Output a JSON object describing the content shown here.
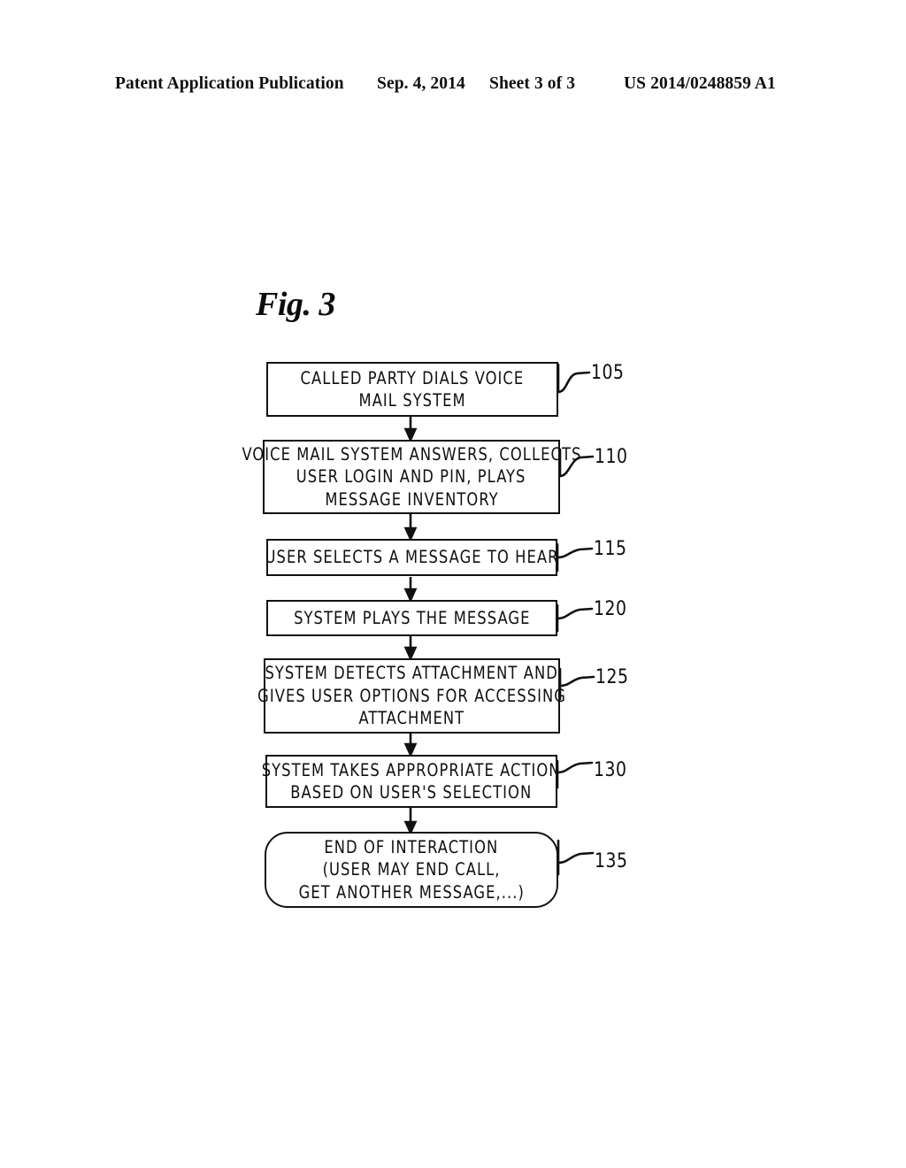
{
  "header": {
    "publication": "Patent Application Publication",
    "date": "Sep. 4, 2014",
    "sheet": "Sheet 3 of 3",
    "patent_number": "US 2014/0248859 A1"
  },
  "figure": {
    "label": "Fig. 3",
    "type": "flowchart",
    "ink_color": "#121010",
    "background_color": "#ffffff"
  },
  "chart_data": {
    "type": "diagram",
    "title": "Fig. 3",
    "nodes": [
      {
        "ref": "105",
        "shape": "rectangle",
        "lines": [
          "CALLED PARTY DIALS VOICE",
          "MAIL SYSTEM"
        ]
      },
      {
        "ref": "110",
        "shape": "rectangle",
        "lines": [
          "VOICE MAIL SYSTEM ANSWERS, COLLECTS",
          "USER LOGIN AND PIN, PLAYS",
          "MESSAGE INVENTORY"
        ]
      },
      {
        "ref": "115",
        "shape": "rectangle",
        "lines": [
          "USER SELECTS A MESSAGE TO HEAR"
        ]
      },
      {
        "ref": "120",
        "shape": "rectangle",
        "lines": [
          "SYSTEM PLAYS THE MESSAGE"
        ]
      },
      {
        "ref": "125",
        "shape": "rectangle",
        "lines": [
          "SYSTEM DETECTS ATTACHMENT AND",
          "GIVES USER OPTIONS FOR ACCESSING",
          "ATTACHMENT"
        ]
      },
      {
        "ref": "130",
        "shape": "rectangle",
        "lines": [
          "SYSTEM TAKES APPROPRIATE ACTION",
          "BASED ON USER'S SELECTION"
        ]
      },
      {
        "ref": "135",
        "shape": "rounded-rectangle",
        "lines": [
          "END OF INTERACTION",
          "(USER MAY END CALL,",
          "GET ANOTHER MESSAGE,...)"
        ]
      }
    ],
    "edges": [
      {
        "from": "105",
        "to": "110",
        "style": "arrow-down"
      },
      {
        "from": "110",
        "to": "115",
        "style": "arrow-down"
      },
      {
        "from": "115",
        "to": "120",
        "style": "arrow-down"
      },
      {
        "from": "120",
        "to": "125",
        "style": "arrow-down"
      },
      {
        "from": "125",
        "to": "130",
        "style": "arrow-down"
      },
      {
        "from": "130",
        "to": "135",
        "style": "arrow-down"
      }
    ]
  },
  "boxes": {
    "b105": {
      "ref": "105",
      "l1": "CALLED PARTY DIALS VOICE",
      "l2": "MAIL SYSTEM"
    },
    "b110": {
      "ref": "110",
      "l1": "VOICE MAIL SYSTEM ANSWERS, COLLECTS",
      "l2": "USER LOGIN AND PIN, PLAYS",
      "l3": "MESSAGE INVENTORY"
    },
    "b115": {
      "ref": "115",
      "l1": "USER SELECTS A MESSAGE TO HEAR"
    },
    "b120": {
      "ref": "120",
      "l1": "SYSTEM PLAYS THE MESSAGE"
    },
    "b125": {
      "ref": "125",
      "l1": "SYSTEM DETECTS ATTACHMENT AND",
      "l2": "GIVES USER OPTIONS FOR ACCESSING",
      "l3": "ATTACHMENT"
    },
    "b130": {
      "ref": "130",
      "l1": "SYSTEM TAKES APPROPRIATE ACTION",
      "l2": "BASED ON USER'S SELECTION"
    },
    "b135": {
      "ref": "135",
      "l1": "END OF INTERACTION",
      "l2": "(USER MAY END CALL,",
      "l3": "GET ANOTHER MESSAGE,...)"
    }
  }
}
